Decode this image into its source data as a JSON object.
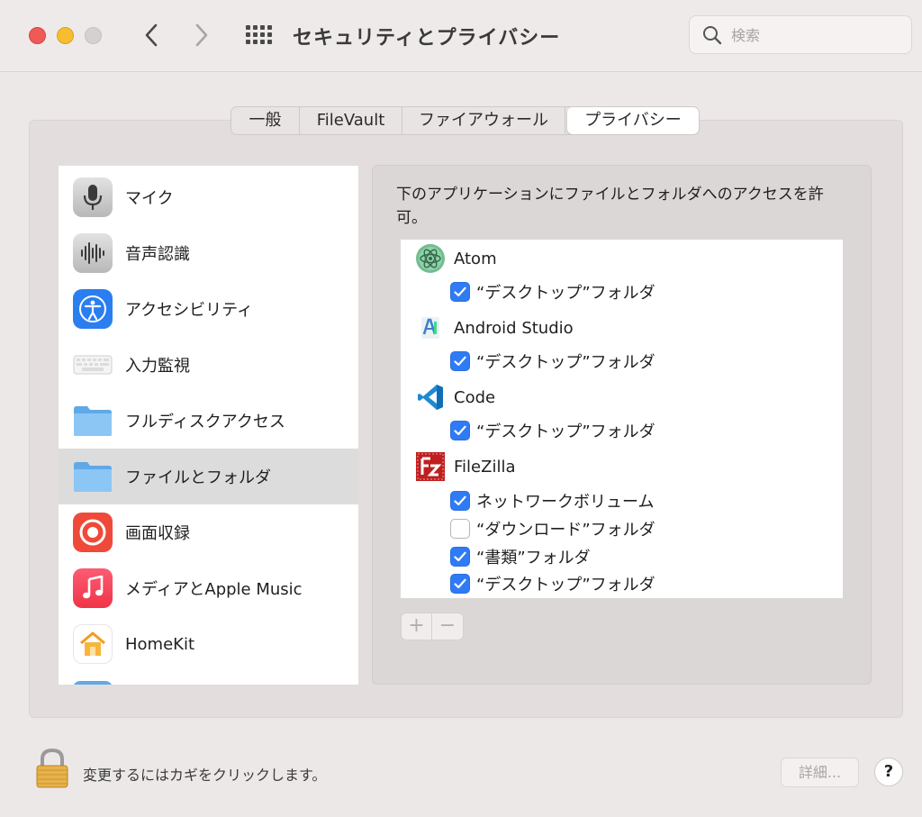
{
  "window": {
    "title": "セキュリティとプライバシー",
    "back_icon": "chevron-left-icon",
    "forward_icon": "chevron-right-icon",
    "grid_icon": "grid-icon"
  },
  "search": {
    "placeholder": "検索",
    "icon": "search-icon"
  },
  "tabs": [
    {
      "label": "一般",
      "active": false
    },
    {
      "label": "FileVault",
      "active": false
    },
    {
      "label": "ファイアウォール",
      "active": false
    },
    {
      "label": "プライバシー",
      "active": true
    }
  ],
  "sidebar": {
    "items": [
      {
        "label": "マイク",
        "icon": "microphone-icon",
        "selected": false
      },
      {
        "label": "音声認識",
        "icon": "waveform-icon",
        "selected": false
      },
      {
        "label": "アクセシビリティ",
        "icon": "accessibility-icon",
        "selected": false
      },
      {
        "label": "入力監視",
        "icon": "keyboard-icon",
        "selected": false
      },
      {
        "label": "フルディスクアクセス",
        "icon": "folder-icon",
        "selected": false
      },
      {
        "label": "ファイルとフォルダ",
        "icon": "folder-icon",
        "selected": true
      },
      {
        "label": "画面収録",
        "icon": "screen-record-icon",
        "selected": false
      },
      {
        "label": "メディアとApple Music",
        "icon": "music-icon",
        "selected": false
      },
      {
        "label": "HomeKit",
        "icon": "home-icon",
        "selected": false
      }
    ]
  },
  "content": {
    "description": "下のアプリケーションにファイルとフォルダへのアクセスを許可。",
    "apps": [
      {
        "name": "Atom",
        "icon": "atom-icon",
        "permissions": [
          {
            "label": "“デスクトップ”フォルダ",
            "checked": true
          }
        ]
      },
      {
        "name": "Android Studio",
        "icon": "android-studio-icon",
        "permissions": [
          {
            "label": "“デスクトップ”フォルダ",
            "checked": true
          }
        ]
      },
      {
        "name": "Code",
        "icon": "vscode-icon",
        "permissions": [
          {
            "label": "“デスクトップ”フォルダ",
            "checked": true
          }
        ]
      },
      {
        "name": "FileZilla",
        "icon": "filezilla-icon",
        "permissions": [
          {
            "label": "ネットワークボリューム",
            "checked": true
          },
          {
            "label": "“ダウンロード”フォルダ",
            "checked": false
          },
          {
            "label": "“書類”フォルダ",
            "checked": true
          },
          {
            "label": "“デスクトップ”フォルダ",
            "checked": true
          }
        ]
      }
    ],
    "add_label": "+",
    "remove_label": "−"
  },
  "footer": {
    "lock_text": "変更するにはカギをクリックします。",
    "lock_icon": "padlock-icon",
    "detail_label": "詳細...",
    "help_label": "?"
  },
  "colors": {
    "checkbox_on": "#2f7bf5",
    "close": "#ee5b57",
    "minimize": "#f5bd2f"
  }
}
